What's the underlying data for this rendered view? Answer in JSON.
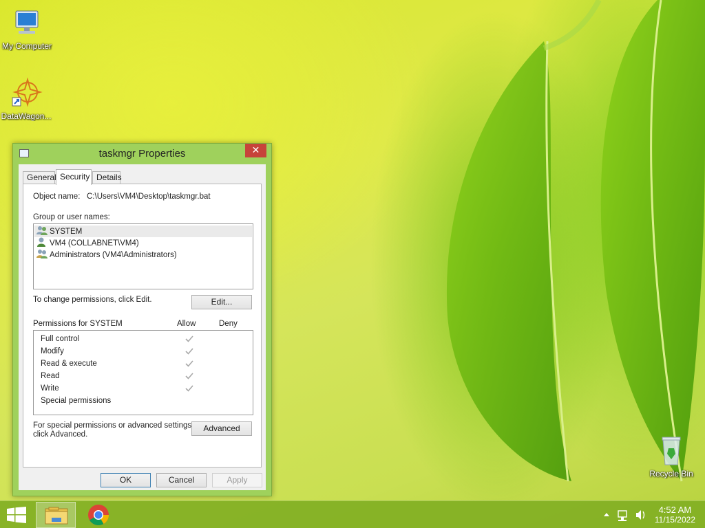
{
  "desktop": {
    "icons": [
      {
        "label": "My Computer"
      },
      {
        "label": "DataWagon..."
      },
      {
        "label": "Recycle Bin"
      }
    ]
  },
  "dialog": {
    "title": "taskmgr Properties",
    "close_label": "✕",
    "tabs": [
      {
        "label": "General"
      },
      {
        "label": "Security"
      },
      {
        "label": "Details"
      }
    ],
    "object_name_label": "Object name:",
    "object_name_value": "C:\\Users\\VM4\\Desktop\\taskmgr.bat",
    "group_label": "Group or user names:",
    "users": [
      {
        "name": "SYSTEM"
      },
      {
        "name": "VM4 (COLLABNET\\VM4)"
      },
      {
        "name": "Administrators (VM4\\Administrators)"
      }
    ],
    "change_hint": "To change permissions, click Edit.",
    "edit_label": "Edit...",
    "permissions_for": "Permissions for SYSTEM",
    "allow_label": "Allow",
    "deny_label": "Deny",
    "permissions": [
      {
        "name": "Full control",
        "allow": true,
        "deny": false
      },
      {
        "name": "Modify",
        "allow": true,
        "deny": false
      },
      {
        "name": "Read & execute",
        "allow": true,
        "deny": false
      },
      {
        "name": "Read",
        "allow": true,
        "deny": false
      },
      {
        "name": "Write",
        "allow": true,
        "deny": false
      },
      {
        "name": "Special permissions",
        "allow": false,
        "deny": false
      }
    ],
    "advanced_hint_line1": "For special permissions or advanced settings,",
    "advanced_hint_line2": "click Advanced.",
    "advanced_label": "Advanced",
    "ok_label": "OK",
    "cancel_label": "Cancel",
    "apply_label": "Apply"
  },
  "taskbar": {
    "apps": [
      {
        "icon": "file-explorer-icon"
      },
      {
        "icon": "chrome-icon"
      }
    ],
    "time": "4:52 AM",
    "date": "11/15/2022"
  },
  "colors": {
    "taskbar": "#82af23",
    "dialog_frame": "#9fd15c",
    "close_button": "#c7433a"
  }
}
